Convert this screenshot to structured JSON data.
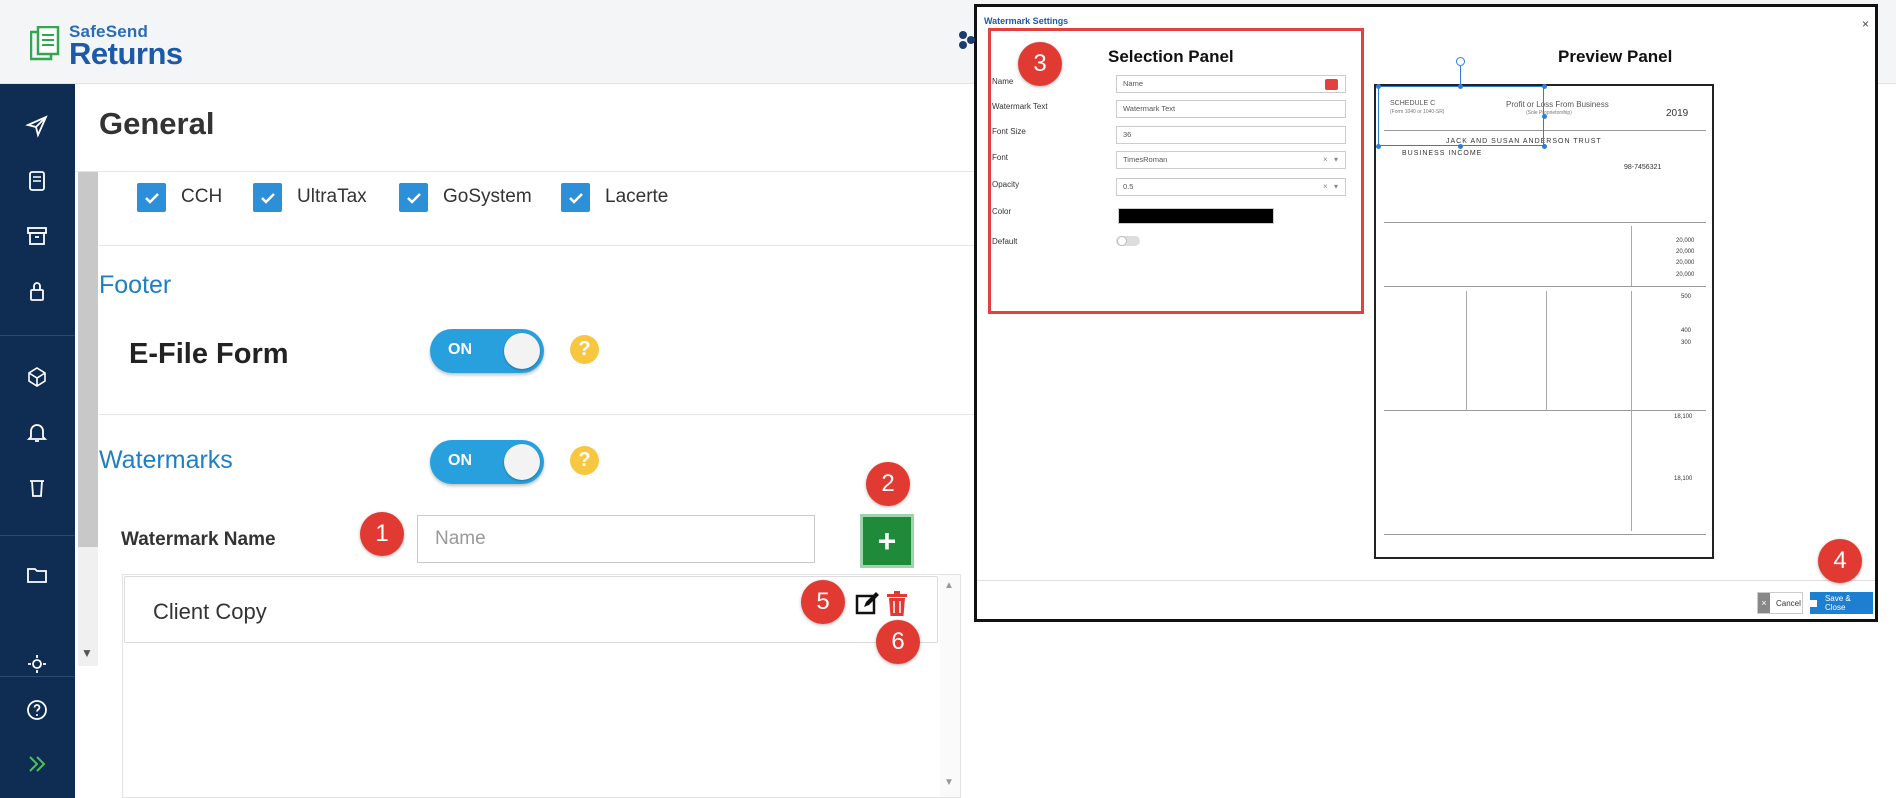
{
  "app": {
    "brand_small": "SafeSend",
    "brand_big": "Returns"
  },
  "sidebar": {
    "items": [
      {
        "icon": "send-icon"
      },
      {
        "icon": "document-icon"
      },
      {
        "icon": "archive-icon"
      },
      {
        "icon": "lock-icon"
      },
      {
        "icon": "cube-icon"
      },
      {
        "icon": "bell-icon"
      },
      {
        "icon": "trash-icon"
      },
      {
        "icon": "folder-icon"
      },
      {
        "icon": "users-gear-icon"
      },
      {
        "icon": "help-icon"
      },
      {
        "icon": "expand-icon"
      }
    ]
  },
  "page": {
    "title": "General"
  },
  "software": {
    "items": [
      {
        "label": "CCH",
        "checked": true
      },
      {
        "label": "UltraTax",
        "checked": true
      },
      {
        "label": "GoSystem",
        "checked": true
      },
      {
        "label": "Lacerte",
        "checked": true
      }
    ]
  },
  "footer": {
    "heading": "Footer",
    "efile_label": "E-File Form",
    "efile_toggle": "ON"
  },
  "watermarks": {
    "heading": "Watermarks",
    "toggle": "ON",
    "name_label": "Watermark Name",
    "name_placeholder": "Name",
    "add_label": "+",
    "list": [
      {
        "name": "Client Copy"
      }
    ]
  },
  "badges": {
    "b1": "1",
    "b2": "2",
    "b3": "3",
    "b4": "4",
    "b5": "5",
    "b6": "6"
  },
  "modal": {
    "title": "Watermark Settings",
    "close": "×",
    "selection_title": "Selection Panel",
    "preview_title": "Preview Panel",
    "fields": {
      "name_label": "Name",
      "name_value": "Name",
      "text_label": "Watermark Text",
      "text_value": "Watermark Text",
      "size_label": "Font Size",
      "size_value": "36",
      "font_label": "Font",
      "font_value": "TimesRoman",
      "opacity_label": "Opacity",
      "opacity_value": "0.5",
      "color_label": "Color",
      "color_value": "#000000",
      "default_label": "Default"
    },
    "cancel_label": "Cancel",
    "cancel_x": "×",
    "save_label": "Save & Close",
    "doc": {
      "form": "SCHEDULE C",
      "form_sub": "(Form 1040 or 1040-SR)",
      "title": "Profit or Loss From Business",
      "subtitle": "(Sole Proprietorship)",
      "year": "2019",
      "name": "JACK AND SUSAN ANDERSON TRUST",
      "business": "BUSINESS INCOME",
      "ein": "98-7456321",
      "values": [
        "20,000",
        "20,000",
        "20,000",
        "20,000",
        "500",
        "400",
        "300",
        "18,100",
        "18,100"
      ]
    }
  }
}
